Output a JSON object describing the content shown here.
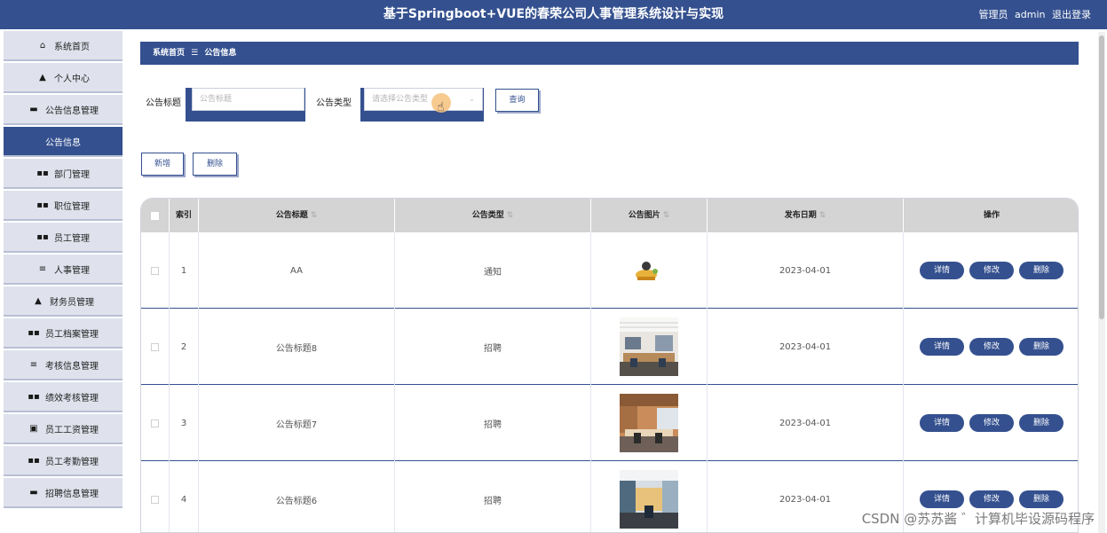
{
  "header": {
    "title": "基于Springboot+VUE的春荣公司人事管理系统设计与实现",
    "role": "管理员",
    "username": "admin",
    "logout": "退出登录"
  },
  "sidebar": {
    "items": [
      {
        "icon": "home-icon",
        "glyph": "⌂",
        "label": "系统首页"
      },
      {
        "icon": "user-icon",
        "glyph": "▲",
        "label": "个人中心"
      },
      {
        "icon": "monitor-icon",
        "glyph": "▬",
        "label": "公告信息管理"
      },
      {
        "icon": "",
        "glyph": "",
        "label": "公告信息",
        "active": true
      },
      {
        "icon": "grid-icon",
        "glyph": "▪▪",
        "label": "部门管理"
      },
      {
        "icon": "grid-icon",
        "glyph": "▪▪",
        "label": "职位管理"
      },
      {
        "icon": "grid-icon",
        "glyph": "▪▪",
        "label": "员工管理"
      },
      {
        "icon": "list-icon",
        "glyph": "≡",
        "label": "人事管理"
      },
      {
        "icon": "user-icon",
        "glyph": "▲",
        "label": "财务员管理"
      },
      {
        "icon": "grid-icon",
        "glyph": "▪▪",
        "label": "员工档案管理"
      },
      {
        "icon": "list-icon",
        "glyph": "≡",
        "label": "考核信息管理"
      },
      {
        "icon": "grid-icon",
        "glyph": "▪▪",
        "label": "绩效考核管理"
      },
      {
        "icon": "clipboard-icon",
        "glyph": "▣",
        "label": "员工工资管理"
      },
      {
        "icon": "grid-icon",
        "glyph": "▪▪",
        "label": "员工考勤管理"
      },
      {
        "icon": "monitor-icon",
        "glyph": "▬",
        "label": "招聘信息管理"
      }
    ]
  },
  "breadcrumb": {
    "home": "系统首页",
    "sep": "☰",
    "current": "公告信息"
  },
  "search": {
    "title_label": "公告标题",
    "title_placeholder": "公告标题",
    "type_label": "公告类型",
    "type_placeholder": "请选择公告类型",
    "query_button": "查询"
  },
  "actions": {
    "add": "新增",
    "delete": "删除"
  },
  "table": {
    "columns": [
      "",
      "索引",
      "公告标题",
      "公告类型",
      "公告图片",
      "发布日期",
      "操作"
    ],
    "rows": [
      {
        "index": "1",
        "title": "AA",
        "type": "通知",
        "date": "2023-04-01",
        "image": "cartoon"
      },
      {
        "index": "2",
        "title": "公告标题8",
        "type": "招聘",
        "date": "2023-04-01",
        "image": "office"
      },
      {
        "index": "3",
        "title": "公告标题7",
        "type": "招聘",
        "date": "2023-04-01",
        "image": "office"
      },
      {
        "index": "4",
        "title": "公告标题6",
        "type": "招聘",
        "date": "2023-04-01",
        "image": "office"
      }
    ],
    "row_buttons": {
      "detail": "详情",
      "edit": "修改",
      "delete": "删除"
    }
  },
  "watermark": "CSDN @苏苏酱 ゛计算机毕设源码程序",
  "colors": {
    "primary": "#34508f",
    "header_bg": "#d4d4d4"
  }
}
